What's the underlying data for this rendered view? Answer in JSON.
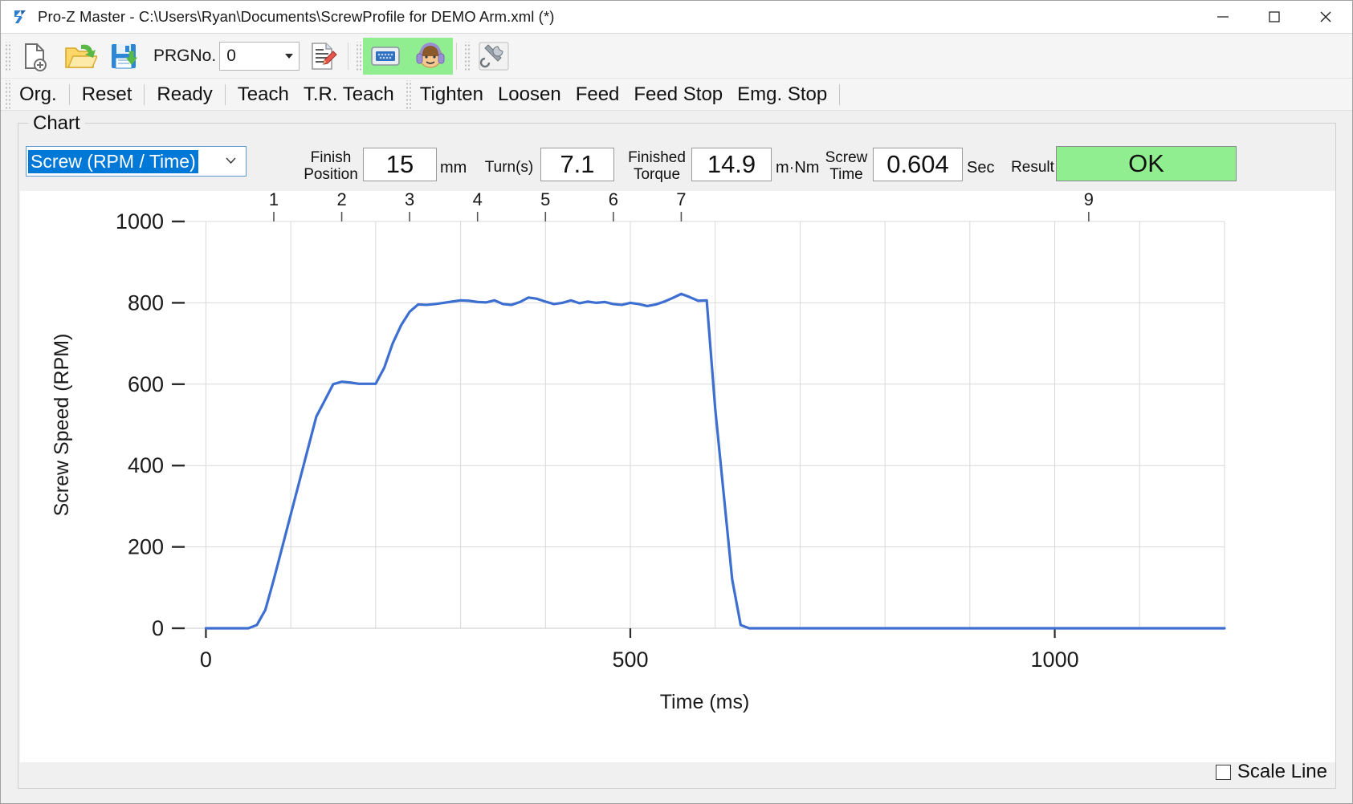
{
  "window": {
    "app_name": "Pro-Z Master",
    "title": "Pro-Z Master - C:\\Users\\Ryan\\Documents\\ScrewProfile for DEMO Arm.xml (*)",
    "minimize_label": "—",
    "maximize_label": "☐",
    "close_label": "✕"
  },
  "toolbar": {
    "new_icon": "new-file-icon",
    "open_icon": "open-folder-icon",
    "save_icon": "save-disk-icon",
    "prg_label": "PRGNo.",
    "prg_value": "0",
    "prg_options": [
      "0"
    ],
    "edit_doc_icon": "edit-document-icon",
    "monitor_icon": "monitor-icon",
    "operator_icon": "operator-headset-icon",
    "tools_icon": "tools-icon",
    "active_color": "#90ee90"
  },
  "commands": [
    "Org.",
    "Reset",
    "Ready",
    "Teach",
    "T.R. Teach",
    "Tighten",
    "Loosen",
    "Feed",
    "Feed Stop",
    "Emg. Stop"
  ],
  "chart_panel": {
    "group_title": "Chart",
    "select_value": "Screw (RPM / Time)",
    "select_options": [
      "Screw (RPM / Time)"
    ],
    "readouts": [
      {
        "label_line1": "Finish",
        "label_line2": "Position",
        "value": "15",
        "unit": "mm"
      },
      {
        "label_line1": "Turn(s)",
        "label_line2": "",
        "value": "7.1",
        "unit": ""
      },
      {
        "label_line1": "Finished",
        "label_line2": "Torque",
        "value": "14.9",
        "unit": "m·Nm"
      },
      {
        "label_line1": "Screw",
        "label_line2": "Time",
        "value": "0.604",
        "unit": "Sec"
      }
    ],
    "result_label": "Result",
    "result_value": "OK",
    "result_color": "#90ee90",
    "scale_line_label": "Scale Line",
    "scale_line_checked": false
  },
  "chart_data": {
    "type": "line",
    "title": "",
    "xlabel": "Time (ms)",
    "ylabel": "Screw Speed (RPM)",
    "xlim": [
      -25,
      1200
    ],
    "ylim": [
      0,
      1000
    ],
    "xticks": [
      0,
      500,
      1000
    ],
    "xtick_labels": [
      "0",
      "500",
      "1000"
    ],
    "yticks": [
      0,
      200,
      400,
      600,
      800,
      1000
    ],
    "ytick_labels": [
      "0",
      "200",
      "400",
      "600",
      "800",
      "1000"
    ],
    "grid": true,
    "legend": null,
    "line_color": "#3d6fd1",
    "line_width": 3.2,
    "top_markers": [
      {
        "label": "1",
        "x": 80
      },
      {
        "label": "2",
        "x": 160
      },
      {
        "label": "3",
        "x": 240
      },
      {
        "label": "4",
        "x": 320
      },
      {
        "label": "5",
        "x": 400
      },
      {
        "label": "6",
        "x": 480
      },
      {
        "label": "7",
        "x": 560
      },
      {
        "label": "9",
        "x": 1040
      }
    ],
    "series": [
      {
        "name": "Screw Speed",
        "x": [
          0,
          10,
          20,
          30,
          40,
          50,
          60,
          70,
          80,
          90,
          100,
          110,
          120,
          130,
          140,
          150,
          160,
          170,
          180,
          190,
          200,
          210,
          220,
          230,
          240,
          250,
          260,
          270,
          280,
          290,
          300,
          310,
          320,
          330,
          340,
          350,
          360,
          370,
          380,
          390,
          400,
          410,
          420,
          430,
          440,
          450,
          460,
          470,
          480,
          490,
          500,
          510,
          520,
          530,
          540,
          550,
          560,
          570,
          580,
          590,
          600,
          610,
          620,
          630,
          640,
          650,
          660,
          670,
          680,
          690,
          700,
          720,
          760,
          800,
          850,
          900,
          950,
          1000,
          1050,
          1100,
          1150,
          1200
        ],
        "y": [
          0,
          0,
          0,
          0,
          0,
          0,
          8,
          45,
          120,
          200,
          280,
          360,
          440,
          520,
          560,
          600,
          606,
          604,
          601,
          601,
          601,
          640,
          700,
          745,
          778,
          796,
          795,
          797,
          800,
          803,
          806,
          805,
          802,
          801,
          806,
          797,
          795,
          802,
          813,
          810,
          803,
          797,
          800,
          806,
          799,
          803,
          800,
          802,
          797,
          795,
          800,
          797,
          792,
          796,
          803,
          812,
          822,
          814,
          805,
          806,
          540,
          330,
          120,
          8,
          0,
          0,
          0,
          0,
          0,
          0,
          0,
          0,
          0,
          0,
          0,
          0,
          0,
          0,
          0,
          0,
          0,
          0
        ]
      }
    ]
  }
}
